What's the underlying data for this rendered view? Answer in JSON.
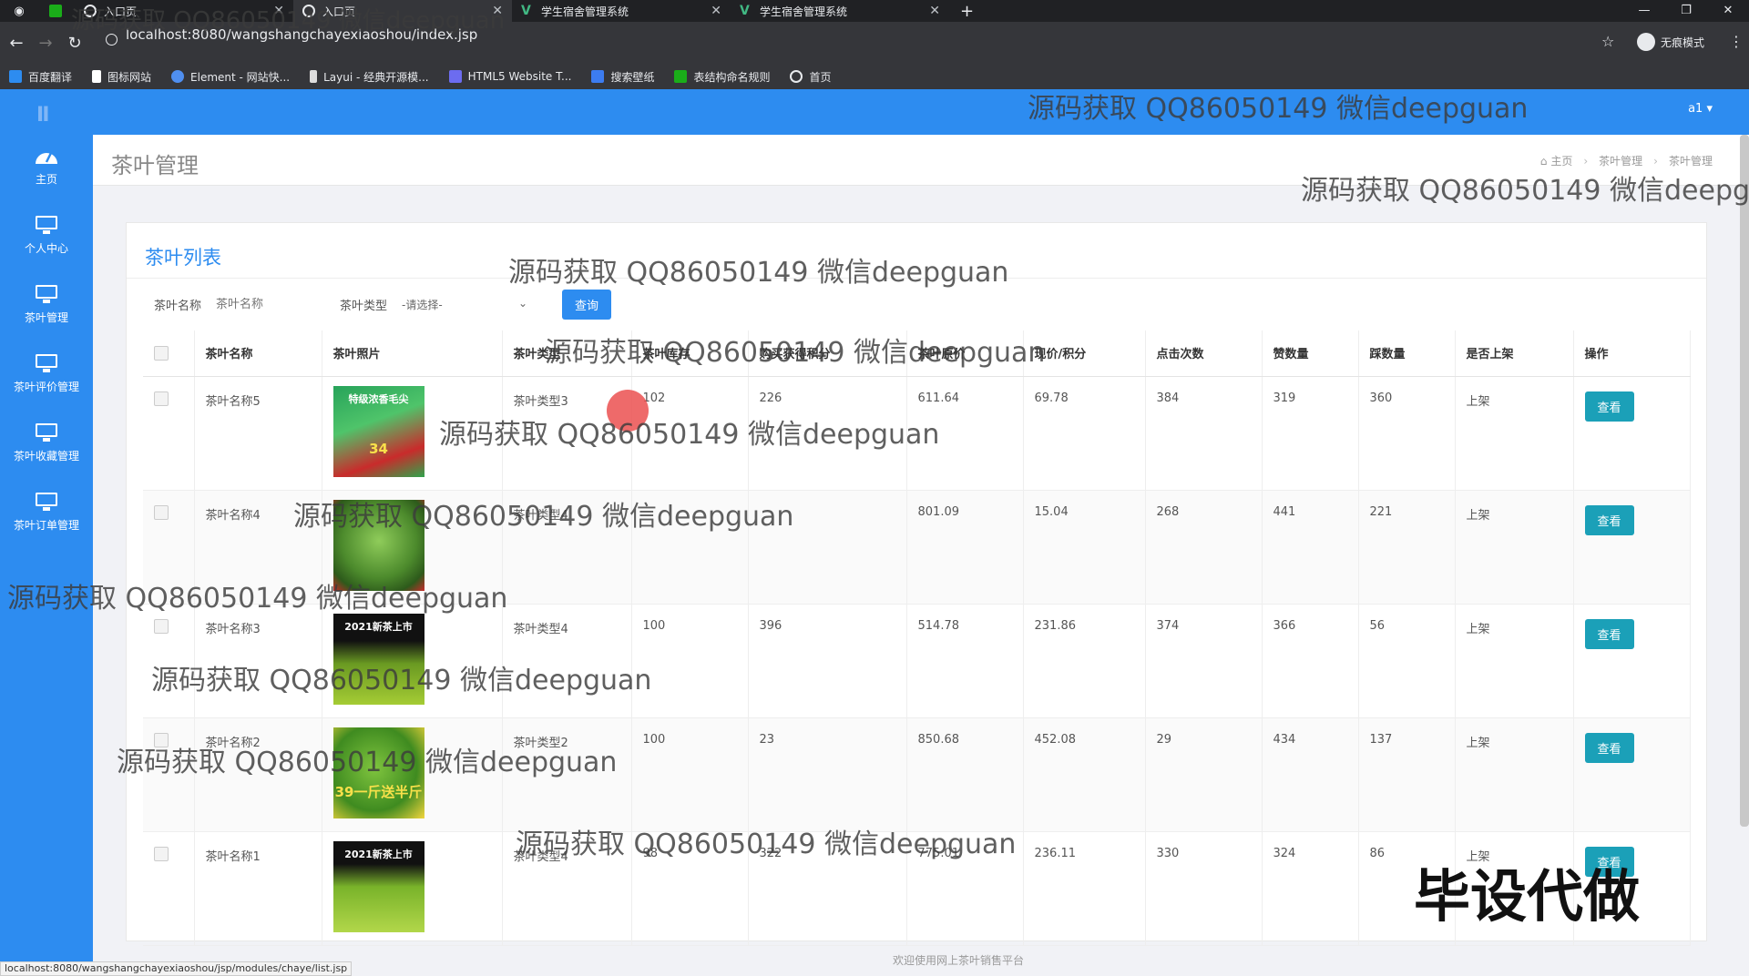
{
  "browser": {
    "tabs": [
      {
        "label": "入口页",
        "active": false
      },
      {
        "label": "入口页",
        "active": true
      },
      {
        "label": "学生宿舍管理系统",
        "active": false
      },
      {
        "label": "学生宿舍管理系统",
        "active": false
      }
    ],
    "new_tab": "+",
    "url": "localhost:8080/wangshangchayexiaoshou/index.jsp",
    "incognito_label": "无痕模式",
    "bookmarks": [
      "百度翻译",
      "图标网站",
      "Element - 网站快...",
      "Layui - 经典开源模...",
      "HTML5 Website T...",
      "搜索壁纸",
      "表结构命名规则",
      "首页"
    ]
  },
  "app": {
    "user_menu": "a1 ▾",
    "sidebar": [
      {
        "label": "主页",
        "icon": "dashboard-icon"
      },
      {
        "label": "个人中心",
        "icon": "monitor-icon"
      },
      {
        "label": "茶叶管理",
        "icon": "monitor-icon"
      },
      {
        "label": "茶叶评价管理",
        "icon": "monitor-icon"
      },
      {
        "label": "茶叶收藏管理",
        "icon": "monitor-icon"
      },
      {
        "label": "茶叶订单管理",
        "icon": "monitor-icon"
      }
    ],
    "page_title": "茶叶管理",
    "breadcrumb": [
      "主页",
      "茶叶管理",
      "茶叶管理"
    ],
    "panel_title": "茶叶列表",
    "search": {
      "name_label": "茶叶名称",
      "name_placeholder": "茶叶名称",
      "type_label": "茶叶类型",
      "type_selected": "-请选择-",
      "query_button": "查询"
    },
    "table": {
      "headers": [
        "茶叶名称",
        "茶叶照片",
        "茶叶类型",
        "茶叶库存",
        "购买获得积分",
        "茶叶原价",
        "现价/积分",
        "点击次数",
        "赞数量",
        "踩数量",
        "是否上架",
        "操作"
      ],
      "rows": [
        {
          "name": "茶叶名称5",
          "photo_caption": "特级浓香毛尖",
          "photo_badge": "34",
          "type": "茶叶类型3",
          "stock": "102",
          "points": "226",
          "price": "611.64",
          "now": "69.78",
          "clicks": "384",
          "likes": "319",
          "dislikes": "360",
          "on_shelf": "上架",
          "action": "查看"
        },
        {
          "name": "茶叶名称4",
          "photo_caption": "",
          "photo_badge": "",
          "type": "茶叶类型4",
          "stock": "",
          "points": "",
          "price": "801.09",
          "now": "15.04",
          "clicks": "268",
          "likes": "441",
          "dislikes": "221",
          "on_shelf": "上架",
          "action": "查看"
        },
        {
          "name": "茶叶名称3",
          "photo_caption": "2021新茶上市",
          "photo_badge": "",
          "type": "茶叶类型4",
          "stock": "100",
          "points": "396",
          "price": "514.78",
          "now": "231.86",
          "clicks": "374",
          "likes": "366",
          "dislikes": "56",
          "on_shelf": "上架",
          "action": "查看"
        },
        {
          "name": "茶叶名称2",
          "photo_caption": "",
          "photo_badge": "39一斤送半斤",
          "type": "茶叶类型2",
          "stock": "100",
          "points": "23",
          "price": "850.68",
          "now": "452.08",
          "clicks": "29",
          "likes": "434",
          "dislikes": "137",
          "on_shelf": "上架",
          "action": "查看"
        },
        {
          "name": "茶叶名称1",
          "photo_caption": "2021新茶上市",
          "photo_badge": "",
          "type": "茶叶类型4",
          "stock": "98",
          "points": "322",
          "price": "775.01",
          "now": "236.11",
          "clicks": "330",
          "likes": "324",
          "dislikes": "86",
          "on_shelf": "上架",
          "action": "查看"
        }
      ]
    },
    "footer": "欢迎使用网上茶叶销售平台"
  },
  "status_bar_url": "localhost:8080/wangshangchayexiaoshou/jsp/modules/chaye/list.jsp",
  "overlays": {
    "watermark": "源码获取 QQ86050149 微信deepguan",
    "watermark_cut": "源码获取 QQ86050149 微信deepgu",
    "big_text": "毕设代做"
  },
  "colors": {
    "accent": "#2d8cf0",
    "view_button": "#1ba0b8"
  }
}
